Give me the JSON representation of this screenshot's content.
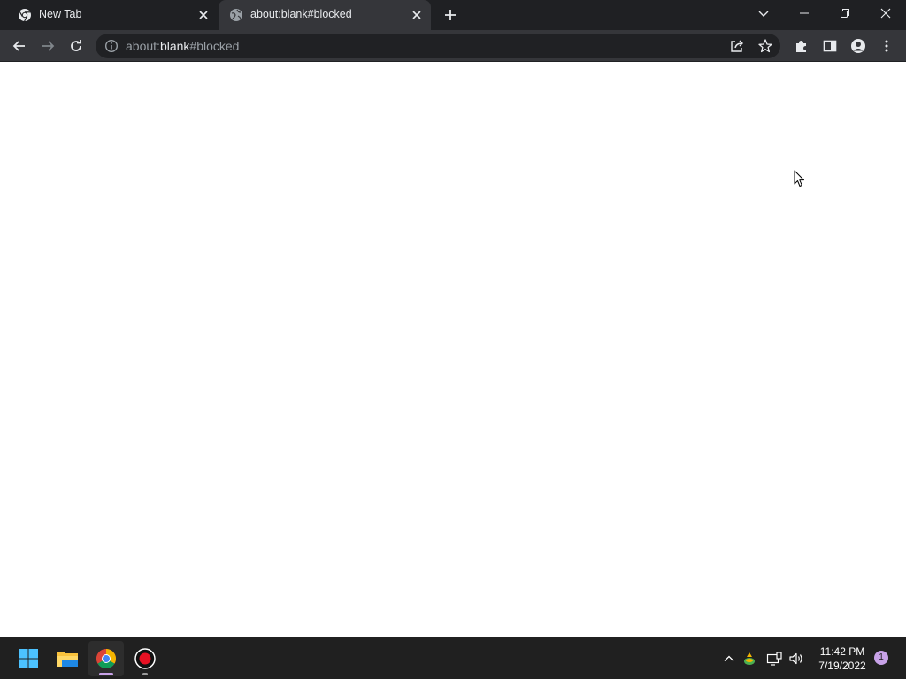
{
  "browser": {
    "tabs": [
      {
        "title": "New Tab",
        "favicon": "chrome-icon",
        "active": false
      },
      {
        "title": "about:blank#blocked",
        "favicon": "globe-icon",
        "active": true
      }
    ],
    "address": {
      "scheme": "about:",
      "host": "blank",
      "fragment": "#blocked"
    }
  },
  "taskbar": {
    "apps": [
      "windows-start-icon",
      "file-explorer-icon",
      "chrome-icon",
      "screen-recorder-icon"
    ],
    "clock": {
      "time": "11:42 PM",
      "date": "7/19/2022"
    },
    "notifications": "1"
  },
  "colors": {
    "tabstrip": "#1f2023",
    "toolbar": "#35363a",
    "omnibox": "#202124",
    "taskbar": "#202020",
    "accent": "#c8a2e8"
  }
}
